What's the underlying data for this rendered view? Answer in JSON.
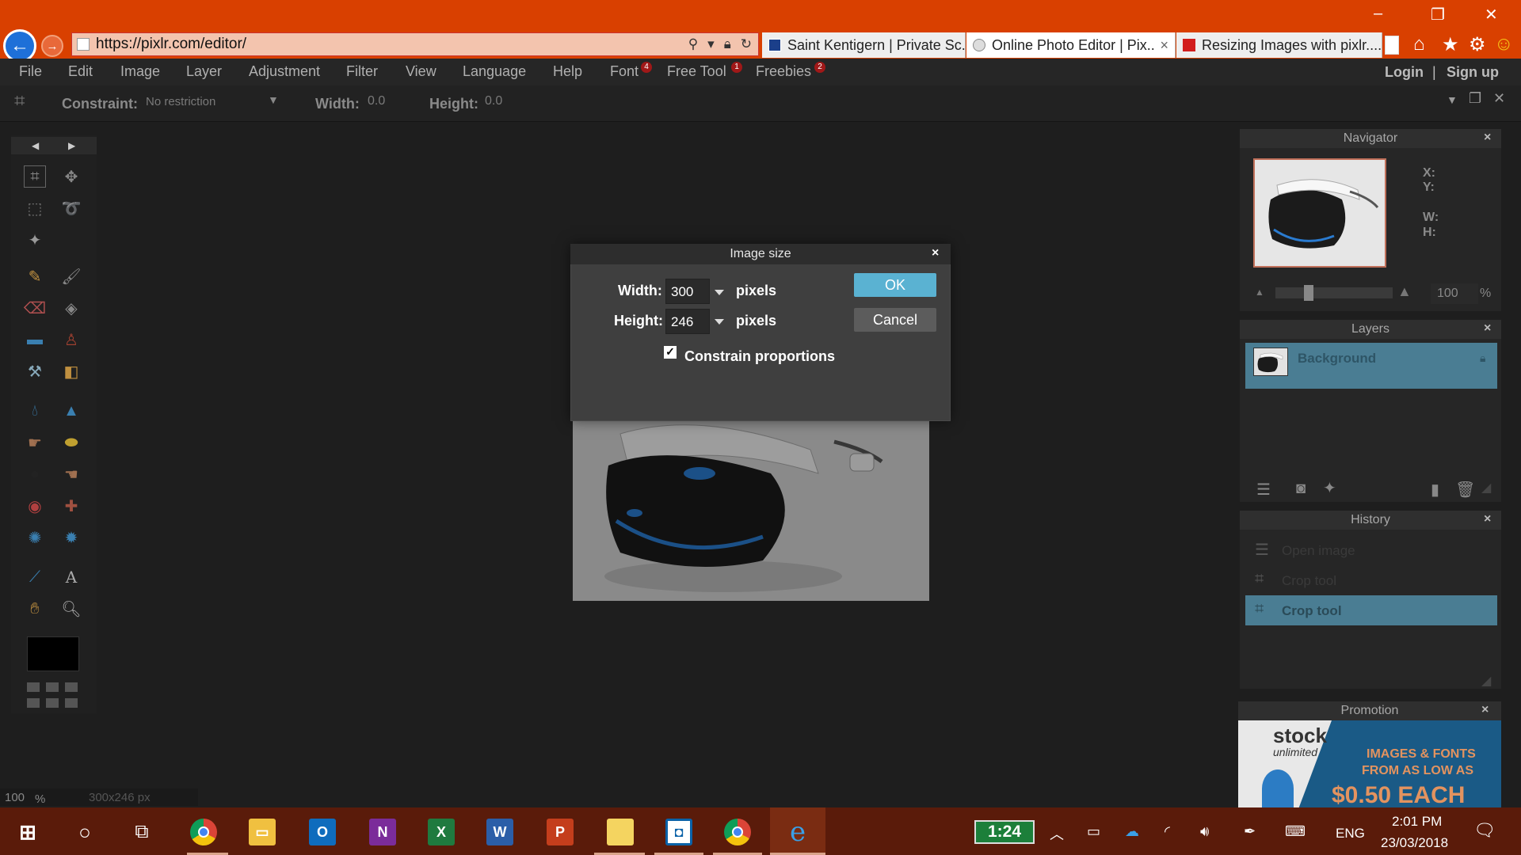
{
  "browser": {
    "url": "https://pixlr.com/editor/",
    "tabs": [
      {
        "title": "Saint Kentigern | Private Sc..."
      },
      {
        "title": "Online Photo Editor | Pix...",
        "close": "×"
      },
      {
        "title": "Resizing Images with pixlr...."
      }
    ]
  },
  "menu": {
    "items": [
      "File",
      "Edit",
      "Image",
      "Layer",
      "Adjustment",
      "Filter",
      "View",
      "Language",
      "Help",
      "Font",
      "Free Tool",
      "Freebies"
    ],
    "badges": {
      "font": "4",
      "free_tool": "1",
      "freebies": "2"
    },
    "login": "Login",
    "separator": "|",
    "signup": "Sign up"
  },
  "options_bar": {
    "constraint_label": "Constraint:",
    "constraint_value": "No restriction",
    "width_label": "Width:",
    "width_value": "0.0",
    "height_label": "Height:",
    "height_value": "0.0"
  },
  "dialog": {
    "title": "Image size",
    "close": "×",
    "width_label": "Width:",
    "width_value": "300",
    "height_label": "Height:",
    "height_value": "246",
    "unit": "pixels",
    "constrain_label": "Constrain proportions",
    "constrain_checked": true,
    "ok_label": "OK",
    "cancel_label": "Cancel"
  },
  "navigator": {
    "title": "Navigator",
    "x_label": "X:",
    "y_label": "Y:",
    "w_label": "W:",
    "h_label": "H:",
    "zoom_value": "100",
    "zoom_unit": "%"
  },
  "layers": {
    "title": "Layers",
    "items": [
      {
        "name": "Background",
        "locked": true
      }
    ]
  },
  "history": {
    "title": "History",
    "items": [
      "Open image",
      "Crop tool",
      "Crop tool"
    ],
    "active_index": 2
  },
  "promotion": {
    "title": "Promotion",
    "brand": "stock",
    "brand_sub": "unlimited",
    "headline_line1": "IMAGES & FONTS",
    "headline_line2": "FROM AS LOW AS",
    "price": "$0.50 EACH"
  },
  "status": {
    "zoom": "100",
    "zoom_unit": "%",
    "dimensions": "300x246 px"
  },
  "taskbar": {
    "battery_time": "1:24",
    "language": "ENG",
    "time": "2:01 PM",
    "date": "23/03/2018"
  },
  "colors": {
    "titlebar": "#d94000",
    "accent": "#5ab2d2",
    "selected_row": "#4a7d93",
    "taskbar": "#5a1b0a"
  }
}
